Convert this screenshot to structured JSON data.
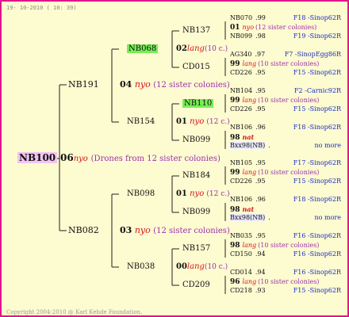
{
  "header": "19- 10-2010 ( 10: 39)",
  "footer": "Copyright 2004-2010 @ Karl Kehde Foundation.",
  "root": {
    "id": "NB100",
    "num": "06",
    "marker": "nyo",
    "note": "(Drones from 12 sister colonies)"
  },
  "g1": [
    {
      "id": "NB191",
      "num": "04",
      "marker": "nyo",
      "note": "(12 sister colonies)"
    },
    {
      "id": "NB082",
      "num": "03",
      "marker": "nyo",
      "note": "(12 sister colonies)"
    }
  ],
  "g2": [
    {
      "id": "NB068",
      "num": "02",
      "marker": "lang",
      "note": "(10 c.)"
    },
    {
      "id": "NB154",
      "num": "01",
      "marker": "nyo",
      "note": "(12 c.)"
    },
    {
      "id": "NB098",
      "num": "01",
      "marker": "nyo",
      "note": "(12 c.)"
    },
    {
      "id": "NB038",
      "num": "00",
      "marker": "lang",
      "note": "(10 c.)"
    }
  ],
  "g3": [
    "NB137",
    "CD015",
    "NB110",
    "NB099",
    "NB184",
    "NB099",
    "NB157",
    "CD209"
  ],
  "g4": [
    {
      "top": "NB070",
      "tq": ".99",
      "tl": "F18 -Sinop62R",
      "num": "01",
      "m": "nyo",
      "note": "(12 sister colonies)",
      "bot": "NB099",
      "bq": ".98",
      "bl": "F19 -Sinop62R"
    },
    {
      "top": "AG340",
      "tq": ".97",
      "tl": "F7 -SinopEgg86R",
      "num": "99",
      "m": "lang",
      "note": "(10 sister colonies)",
      "bot": "CD226",
      "bq": ".95",
      "bl": "F15 -Sinop62R"
    },
    {
      "top": "NB104",
      "tq": ".95",
      "tl": "F2 -Carnic92R",
      "num": "99",
      "m": "lang",
      "note": "(10 sister colonies)",
      "bot": "CD226",
      "bq": ".95",
      "bl": "F15 -Sinop62R"
    },
    {
      "top": "NB106",
      "tq": ".96",
      "tl": "F18 -Sinop62R",
      "num": "98",
      "m": "nat",
      "note": "",
      "bot": "Bxx98(NB)",
      "bq": ".",
      "bl": "no more"
    },
    {
      "top": "NB105",
      "tq": ".95",
      "tl": "F17 -Sinop62R",
      "num": "99",
      "m": "lang",
      "note": "(10 sister colonies)",
      "bot": "CD226",
      "bq": ".95",
      "bl": "F15 -Sinop62R"
    },
    {
      "top": "NB106",
      "tq": ".96",
      "tl": "F18 -Sinop62R",
      "num": "98",
      "m": "nat",
      "note": "",
      "bot": "Bxx98(NB)",
      "bq": ".",
      "bl": "no more"
    },
    {
      "top": "NB035",
      "tq": ".95",
      "tl": "F16 -Sinop62R",
      "num": "98",
      "m": "lang",
      "note": "(10 sister colonies)",
      "bot": "CD150",
      "bq": ".94",
      "bl": "F16 -Sinop62R"
    },
    {
      "top": "CD014",
      "tq": ".94",
      "tl": "F16 -Sinop62R",
      "num": "96",
      "m": "lang",
      "note": "(10 sister colonies)",
      "bot": "CD218",
      "bq": ".93",
      "bl": "F15 -Sinop62R"
    }
  ]
}
